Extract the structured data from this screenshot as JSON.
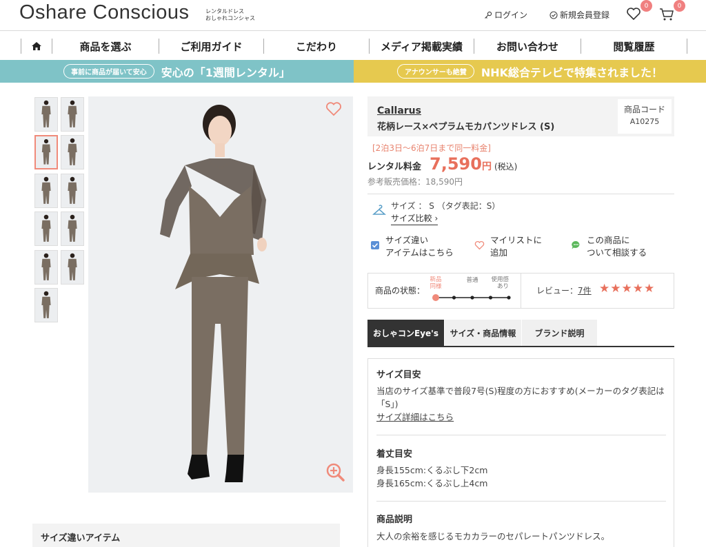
{
  "header": {
    "logo": "Oshare Conscious",
    "logo_sub_1": "レンタルドレス",
    "logo_sub_2": "おしゃれコンシャス",
    "login": "ログイン",
    "register": "新規会員登録",
    "favorites_count": "0",
    "cart_count": "0"
  },
  "nav": {
    "items": [
      "商品を選ぶ",
      "ご利用ガイド",
      "こだわり",
      "メディア掲載実績",
      "お問い合わせ",
      "閲覧履歴"
    ]
  },
  "banners": {
    "left_pill": "事前に商品が届いて安心",
    "left_text": "安心の「1週間レンタル」",
    "right_pill": "アナウンサーも絶賛",
    "right_text": "NHK総合テレビで特集されました！"
  },
  "product": {
    "brand": "Callarus",
    "name": "花柄レース×ペプラムモカパンツドレス (S)",
    "code_label": "商品コード",
    "code": "A10275",
    "same_price_note": "[2泊3日〜6泊7日まで同一料金]",
    "price_label": "レンタル料金",
    "price": "7,590",
    "price_unit": "円",
    "tax": "(税込)",
    "ref_price": "参考販売価格：18,590円",
    "size_text": "サイズ ： S （タグ表記：S）",
    "size_compare": "サイズ比較 ›",
    "action_size_1": "サイズ違い",
    "action_size_2": "アイテムはこちら",
    "action_mylist_1": "マイリストに",
    "action_mylist_2": "追加",
    "action_consult_1": "この商品に",
    "action_consult_2": "ついて相談する",
    "condition_label": "商品の状態：",
    "condition_levels": [
      "新品同様",
      "普通",
      "使用感あり"
    ],
    "condition_level_index": 0,
    "review_label": "レビュー：",
    "review_count": "7件",
    "stars": "★★★★★"
  },
  "tabs": [
    "おしゃコンEye's",
    "サイズ・商品情報",
    "ブランド説明"
  ],
  "detail": {
    "size_head": "サイズ目安",
    "size_body": "当店のサイズ基準で普段7号(S)程度の方におすすめ(メーカーのタグ表記は「S」)",
    "size_link": "サイズ詳細はこちら",
    "length_head": "着丈目安",
    "length_1": "身長155cm:くるぶし下2cm",
    "length_2": "身長165cm:くるぶし上4cm",
    "desc_head": "商品説明",
    "desc_body": "大人の余裕を感じるモカカラーのセパレートパンツドレス。"
  },
  "size_items_heading": "サイズ違いアイテム",
  "colors": {
    "accent": "#e8705c",
    "teal": "#7fc3c7",
    "gold": "#e6c94f",
    "dress": "#7a6e62"
  }
}
